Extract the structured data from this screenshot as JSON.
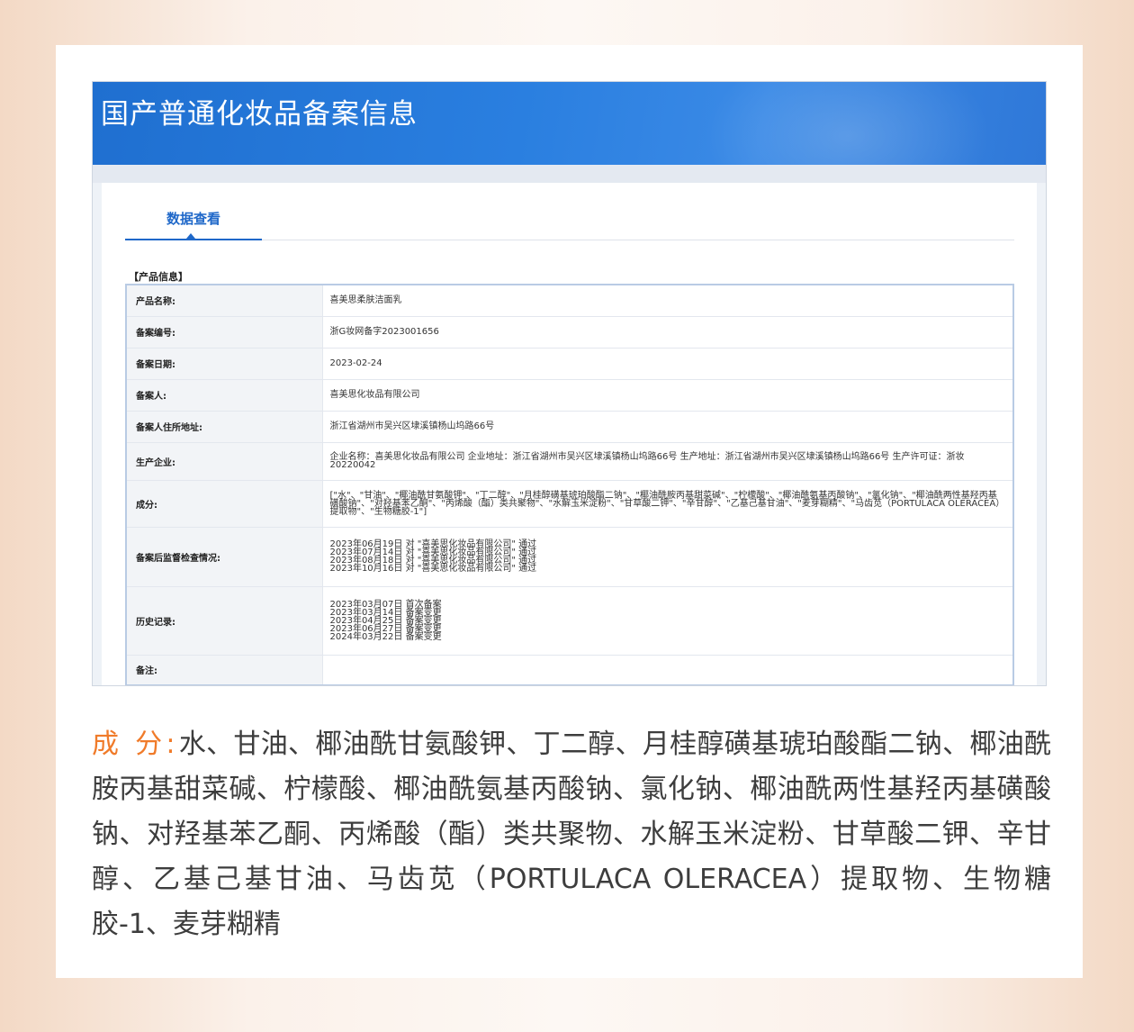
{
  "banner": {
    "title": "国产普通化妆品备案信息"
  },
  "tab": {
    "label": "数据查看"
  },
  "section": {
    "label": "【产品信息】"
  },
  "rows": [
    {
      "k": "产品名称:",
      "v": "喜美思柔肤洁面乳"
    },
    {
      "k": "备案编号:",
      "v": "浙G妆网备字2023001656"
    },
    {
      "k": "备案日期:",
      "v": "2023-02-24"
    },
    {
      "k": "备案人:",
      "v": "喜美思化妆品有限公司"
    },
    {
      "k": "备案人住所地址:",
      "v": "浙江省湖州市吴兴区埭溪镇杨山坞路66号"
    },
    {
      "k": "生产企业:",
      "v": "企业名称：喜美思化妆品有限公司 企业地址：浙江省湖州市吴兴区埭溪镇杨山坞路66号 生产地址：浙江省湖州市吴兴区埭溪镇杨山坞路66号 生产许可证：浙妆20220042"
    },
    {
      "k": "成分:",
      "v": "[\"水\"、\"甘油\"、\"椰油酰甘氨酸钾\"、\"丁二醇\"、\"月桂醇磺基琥珀酸酯二钠\"、\"椰油酰胺丙基甜菜碱\"、\"柠檬酸\"、\"椰油酰氨基丙酸钠\"、\"氯化钠\"、\"椰油酰两性基羟丙基磺酸钠\"、\"对羟基苯乙酮\"、\"丙烯酸（酯）类共聚物\"、\"水解玉米淀粉\"、\"甘草酸二钾\"、\"辛甘醇\"、\"乙基己基甘油\"、\"麦芽糊精\"、\"马齿苋（PORTULACA OLERACEA）提取物\"、\"生物糖胶-1\"]"
    },
    {
      "k": "备案后监督检查情况:",
      "v": "2023年06月19日 对 \"喜美思化妆品有限公司\" 通过\n2023年07月14日 对 \"喜美思化妆品有限公司\" 通过\n2023年08月18日 对 \"喜美思化妆品有限公司\" 通过\n2023年10月16日 对 \"喜美思化妆品有限公司\" 通过"
    },
    {
      "k": "历史记录:",
      "v": "2023年03月07日 首次备案\n2023年03月14日 备案变更\n2023年04月25日 备案变更\n2023年06月27日 备案变更\n2024年03月22日 备案变更"
    },
    {
      "k": "备注:",
      "v": ""
    }
  ],
  "caption": {
    "label": "成 分:",
    "text": "水、甘油、椰油酰甘氨酸钾、丁二醇、月桂醇磺基琥珀酸酯二钠、椰油酰胺丙基甜菜碱、柠檬酸、椰油酰氨基丙酸钠、氯化钠、椰油酰两性基羟丙基磺酸钠、对羟基苯乙酮、丙烯酸（酯）类共聚物、水解玉米淀粉、甘草酸二钾、辛甘醇、乙基己基甘油、马齿苋（PORTULACA OLERACEA）提取物、生物糖 胶-1、麦芽糊精"
  }
}
